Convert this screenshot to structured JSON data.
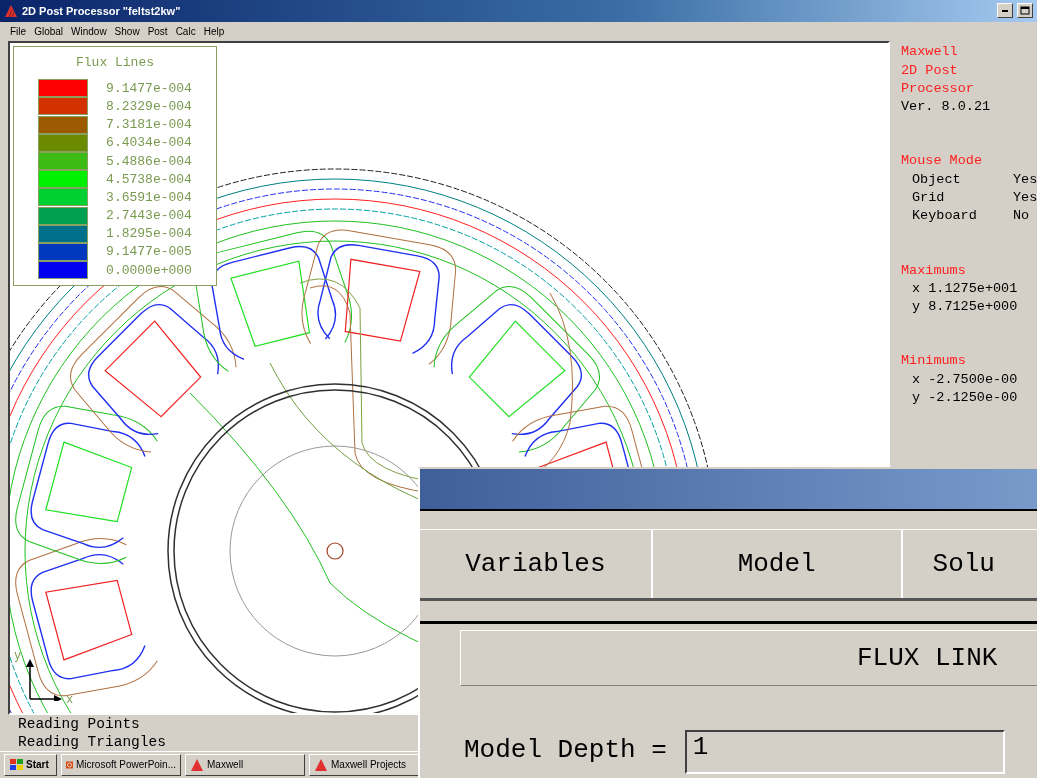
{
  "window": {
    "title": "2D Post Processor \"feltst2kw\""
  },
  "menu": [
    "File",
    "Global",
    "Window",
    "Show",
    "Post",
    "Calc",
    "Help"
  ],
  "legend": {
    "title": "Flux Lines",
    "entries": [
      {
        "label": "9.1477e-004",
        "color": "#ff0000"
      },
      {
        "label": "8.2329e-004",
        "color": "#d23200"
      },
      {
        "label": "7.3181e-004",
        "color": "#9b5a00"
      },
      {
        "label": "6.4034e-004",
        "color": "#6b8a00"
      },
      {
        "label": "5.4886e-004",
        "color": "#3cbb14"
      },
      {
        "label": "4.5738e-004",
        "color": "#00f000"
      },
      {
        "label": "3.6591e-004",
        "color": "#00d030"
      },
      {
        "label": "2.7443e-004",
        "color": "#00a050"
      },
      {
        "label": "1.8295e-004",
        "color": "#00708a"
      },
      {
        "label": "9.1477e-005",
        "color": "#0038c0"
      },
      {
        "label": "0.0000e+000",
        "color": "#0000f0"
      }
    ]
  },
  "axis_labels": {
    "x": "x",
    "y": "y"
  },
  "info_panel": {
    "title_lines": [
      "Maxwell",
      "2D Post",
      "Processor"
    ],
    "version": "Ver. 8.0.21",
    "mouse_mode": {
      "heading": "Mouse Mode",
      "rows": [
        {
          "name": "Object",
          "value": "Yes"
        },
        {
          "name": "Grid",
          "value": "Yes"
        },
        {
          "name": "Keyboard",
          "value": "No"
        }
      ]
    },
    "maximums": {
      "heading": "Maximums",
      "rows": [
        "x 1.1275e+001",
        "y 8.7125e+000"
      ]
    },
    "minimums": {
      "heading": "Minimums",
      "rows": [
        "x -2.7500e-00",
        "y -2.1250e-00"
      ]
    }
  },
  "status_lines": [
    "Reading Points",
    "Reading Triangles"
  ],
  "taskbar": {
    "start": "Start",
    "tasks": [
      {
        "label": "Microsoft PowerPoin...",
        "kind": "powerpoint"
      },
      {
        "label": "Maxwell",
        "kind": "maxwell"
      },
      {
        "label": "Maxwell Projects",
        "kind": "maxwell"
      }
    ]
  },
  "dialog": {
    "tabs": [
      "Variables",
      "Model",
      "Solu"
    ],
    "heading": "FLUX LINK",
    "field": {
      "label": "Model Depth =",
      "value": "1"
    }
  }
}
